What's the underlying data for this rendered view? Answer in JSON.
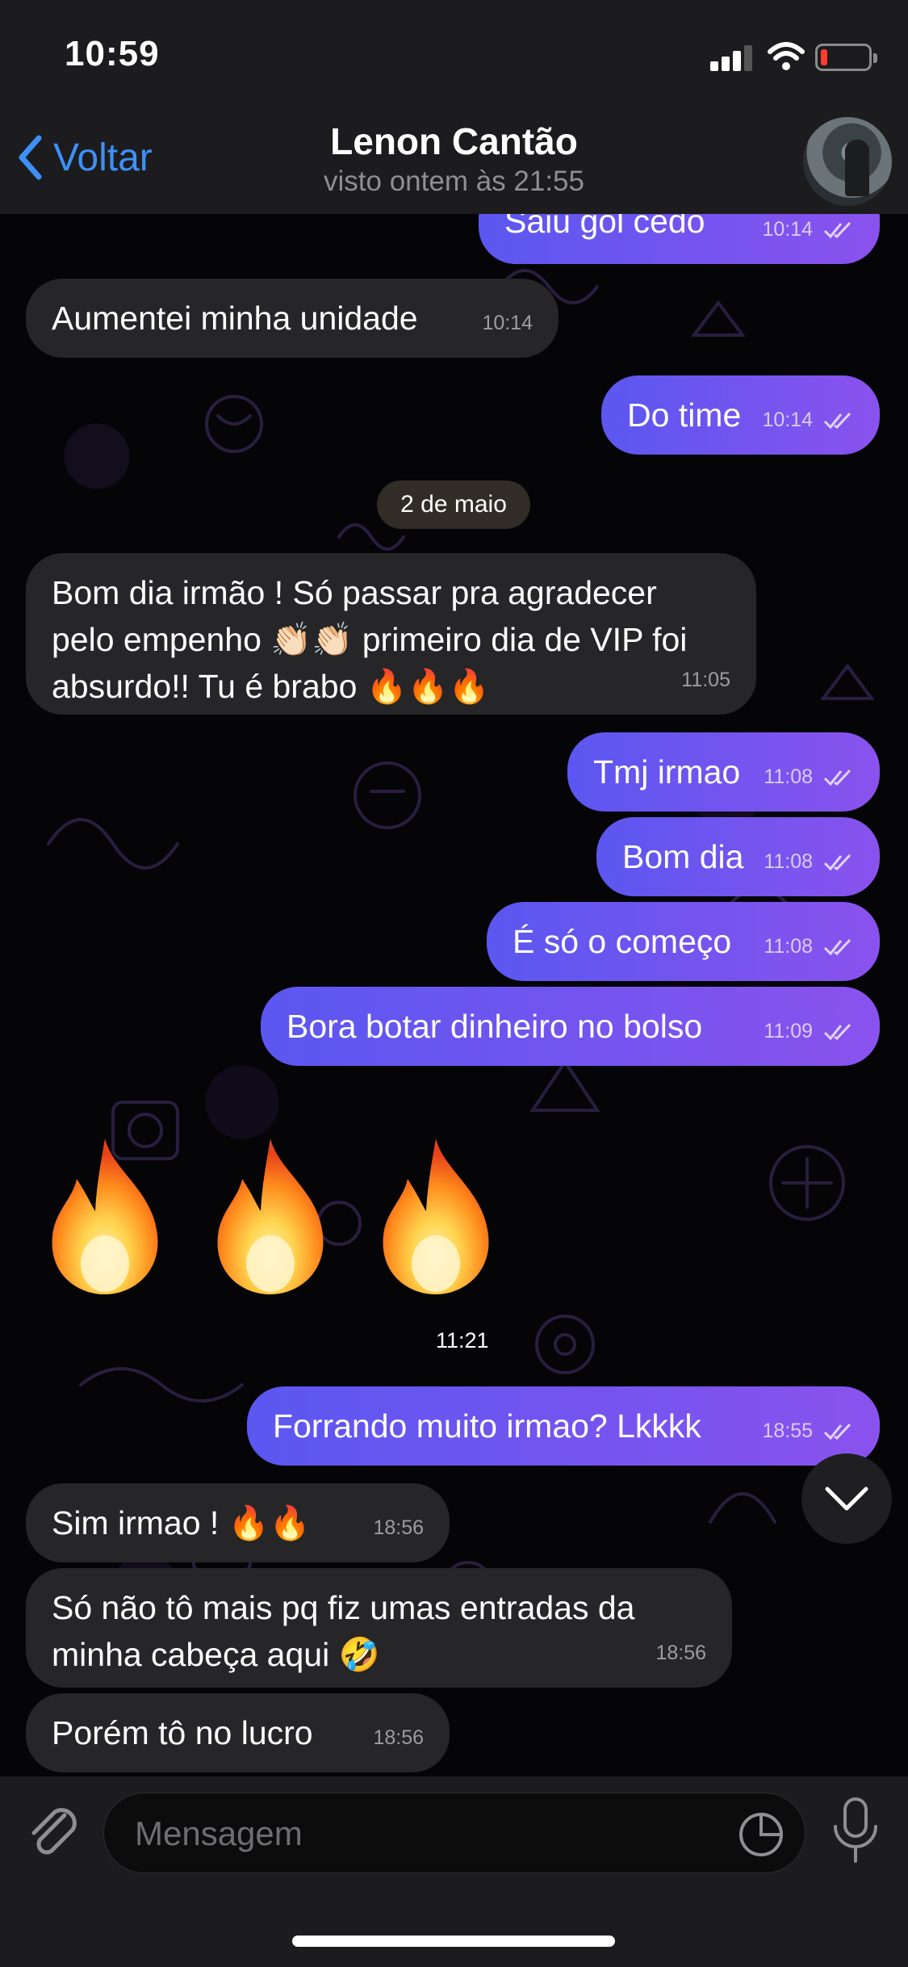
{
  "status_bar": {
    "time": "10:59"
  },
  "header": {
    "back_label": "Voltar",
    "contact_name": "Lenon Cantão",
    "last_seen": "visto ontem às 21:55"
  },
  "messages": [
    {
      "dir": "out",
      "text": "Saiu gol cedo",
      "time": "10:14"
    },
    {
      "dir": "in",
      "text": "Aumentei minha unidade",
      "time": "10:14"
    },
    {
      "dir": "out",
      "text": "Do time",
      "time": "10:14"
    },
    {
      "dir": "in",
      "text": "Bom dia irmão ! Só passar pra agradecer pelo empenho 👏🏻👏🏻 primeiro dia de VIP foi absurdo!! Tu é brabo 🔥🔥🔥",
      "time": "11:05"
    },
    {
      "dir": "out",
      "text": "Tmj irmao",
      "time": "11:08"
    },
    {
      "dir": "out",
      "text": "Bom dia",
      "time": "11:08"
    },
    {
      "dir": "out",
      "text": "É só o começo",
      "time": "11:08"
    },
    {
      "dir": "out",
      "text": "Bora botar dinheiro no bolso",
      "time": "11:09"
    },
    {
      "dir": "out",
      "text": "Forrando muito irmao? Lkkkk",
      "time": "18:55"
    },
    {
      "dir": "in",
      "text": "Sim irmao ! 🔥🔥",
      "time": "18:56"
    },
    {
      "dir": "in",
      "text": "Só não tô mais pq fiz umas entradas da minha cabeça aqui 🤣",
      "time": "18:56"
    },
    {
      "dir": "in",
      "text": "Porém tô no lucro",
      "time": "18:56"
    }
  ],
  "date_separator": "2 de maio",
  "emoji_message": {
    "count": 3,
    "emoji": "fire",
    "time": "11:21"
  },
  "input": {
    "placeholder": "Mensagem"
  },
  "colors": {
    "accent": "#3e8ff7",
    "outgoing_start": "#5b57f0",
    "outgoing_end": "#8a52ee",
    "incoming": "#262527"
  }
}
